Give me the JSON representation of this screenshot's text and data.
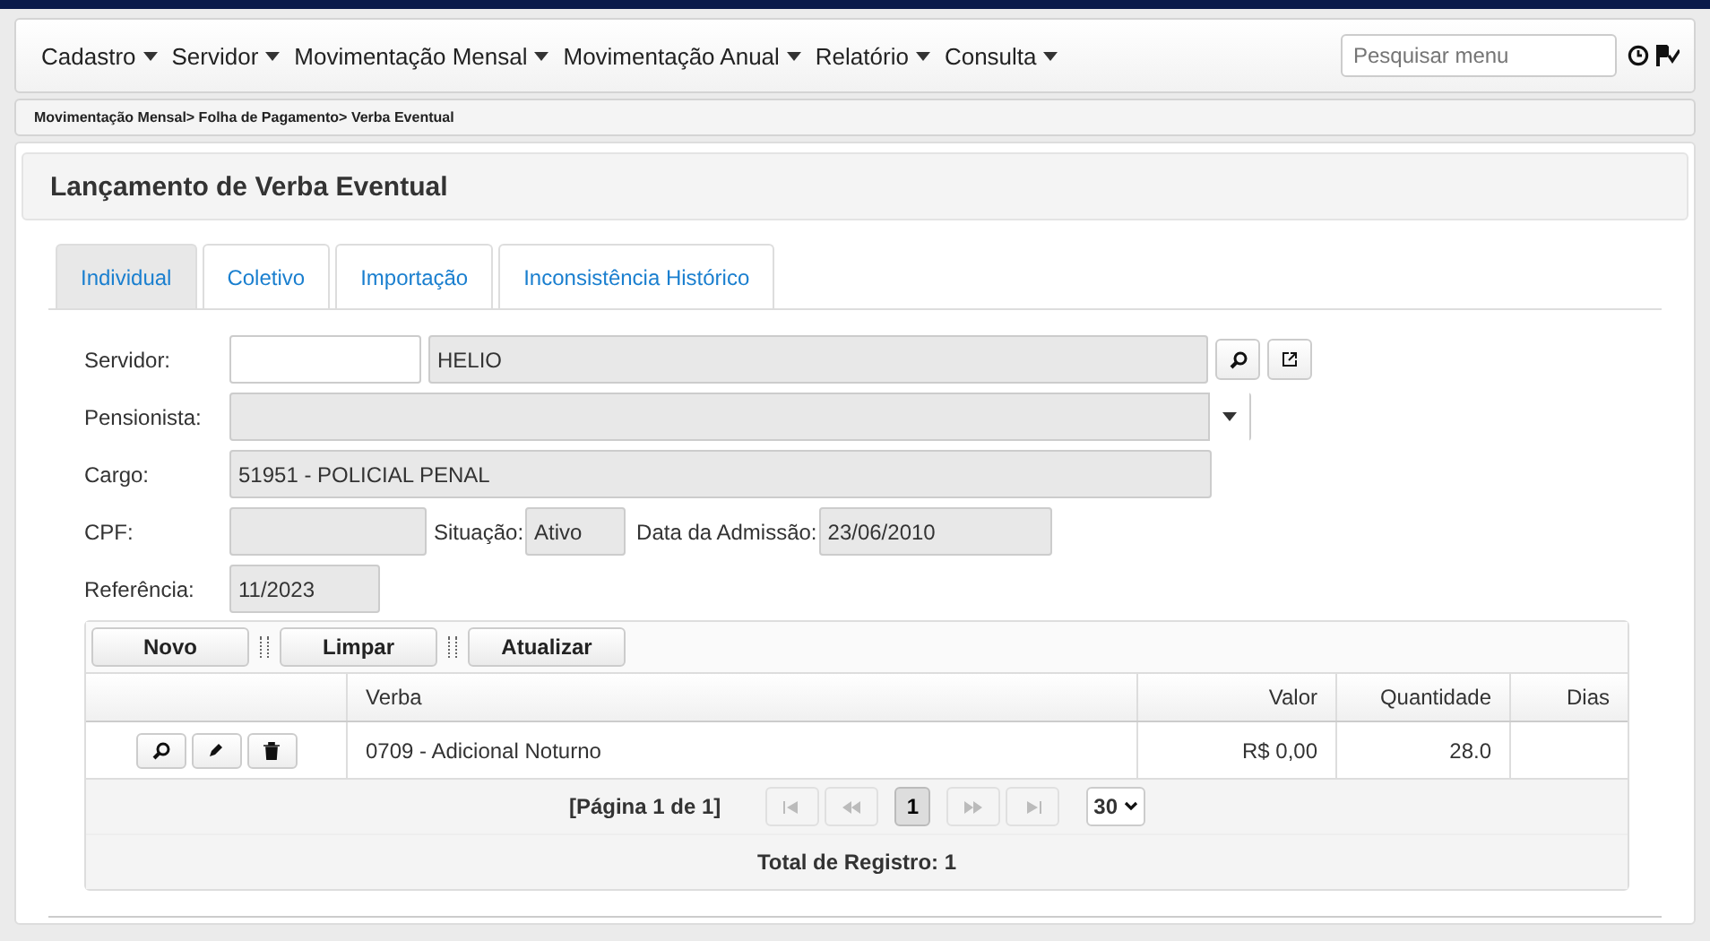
{
  "menu": [
    {
      "label": "Cadastro"
    },
    {
      "label": "Servidor"
    },
    {
      "label": "Movimentação Mensal"
    },
    {
      "label": "Movimentação Anual"
    },
    {
      "label": "Relatório"
    },
    {
      "label": "Consulta"
    }
  ],
  "search": {
    "placeholder": "Pesquisar menu"
  },
  "breadcrumb": "Movimentação Mensal> Folha de Pagamento> Verba Eventual",
  "title": "Lançamento de Verba Eventual",
  "tabs": [
    {
      "label": "Individual",
      "selected": true
    },
    {
      "label": "Coletivo",
      "selected": false
    },
    {
      "label": "Importação",
      "selected": false
    },
    {
      "label": "Inconsistência Histórico",
      "selected": false
    }
  ],
  "form": {
    "servidor": {
      "label": "Servidor:",
      "name": "HELIO"
    },
    "pensionista": {
      "label": "Pensionista:"
    },
    "cargo": {
      "label": "Cargo:",
      "value": "51951 - POLICIAL PENAL"
    },
    "cpf": {
      "label": "CPF:"
    },
    "situacao": {
      "label": "Situação:",
      "value": "Ativo"
    },
    "admissao": {
      "label": "Data da Admissão:",
      "value": "23/06/2010"
    },
    "referencia": {
      "label": "Referência:",
      "value": "11/2023"
    }
  },
  "toolbar": [
    "Novo",
    "Limpar",
    "Atualizar"
  ],
  "table": {
    "columns": [
      "Verba",
      "Valor",
      "Quantidade",
      "Dias"
    ],
    "rows": [
      {
        "verba": "0709 - Adicional Noturno",
        "valor": "R$ 0,00",
        "quantidade": "28.0"
      }
    ]
  },
  "pager": {
    "info": "[Página 1 de 1]",
    "pages": [
      {
        "label": "1",
        "selected": true
      }
    ],
    "page_size": "30"
  },
  "total": "Total de Registro: 1"
}
